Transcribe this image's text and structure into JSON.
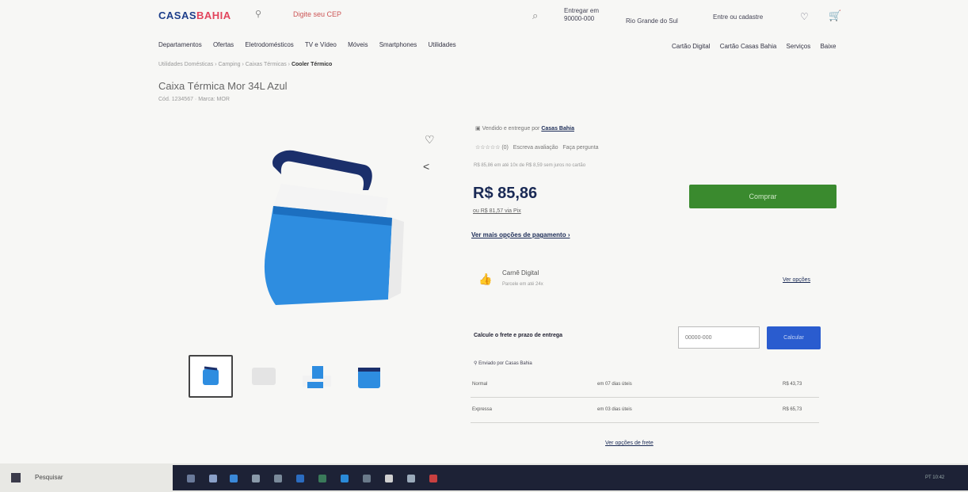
{
  "header": {
    "logo_part1": "CASAS",
    "logo_part2": "BAHIA",
    "location_text": "Digite seu CEP",
    "delivery_line1": "Entregar em",
    "delivery_line2": "90000-000",
    "delivery_city": "Rio Grande do Sul",
    "login_label": "Entre ou cadastre",
    "cart_icon": "cart-icon"
  },
  "nav": {
    "items": [
      "Departamentos",
      "Ofertas",
      "Eletrodomésticos",
      "TV e Vídeo",
      "Móveis",
      "Smartphones",
      "Utilidades"
    ],
    "right_items": [
      "Cartão Digital",
      "Cartão Casas Bahia",
      "Serviços",
      "Baixe"
    ]
  },
  "breadcrumb": {
    "items": [
      "Utilidades Domésticas",
      "Camping",
      "Caixas Térmicas"
    ],
    "current": "Cooler Térmico"
  },
  "product": {
    "title": "Caixa Térmica Mor 34L Azul",
    "subtitle": "Cód. 1234567 · Marca: MOR",
    "seller": "Vendido e entregue por",
    "seller_name": "Casas Bahia",
    "rating_text": "☆☆☆☆☆ (0)",
    "review_label": "Escreva avaliação",
    "question_label": "Faça pergunta",
    "installments": "R$ 85,86 em até 10x de R$ 8,59 sem juros no cartão",
    "price": "R$ 85,86",
    "price_note": "ou R$ 81,57 via Pix",
    "payment_link": "Ver mais opções de pagamento ›",
    "buy_label": "Comprar"
  },
  "service": {
    "name": "Carnê Digital",
    "sub": "Parcele em até 24x",
    "more": "Ver opções"
  },
  "freight": {
    "label": "Calcule o frete e prazo de entrega",
    "cep_placeholder": "00000-000",
    "calc_label": "Calcular",
    "ship_from": "Enviado por Casas Bahia",
    "rows": [
      {
        "name": "Normal",
        "eta": "em 07 dias úteis",
        "price": "R$ 43,73"
      },
      {
        "name": "Expressa",
        "eta": "em 03 dias úteis",
        "price": "R$ 65,73"
      }
    ],
    "more": "Ver opções de frete"
  },
  "taskbar": {
    "search": "Pesquisar",
    "tray": "PT 10:42"
  },
  "colors": {
    "brand_blue": "#1d3e8a",
    "brand_red": "#e2445c",
    "buy_green": "#3a8a2e",
    "calc_blue": "#2a5ccf"
  }
}
